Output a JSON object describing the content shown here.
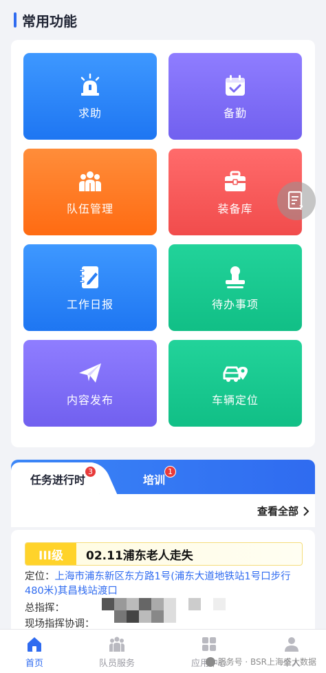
{
  "section": {
    "title": "常用功能"
  },
  "tiles": [
    {
      "label": "求助",
      "icon": "alarm-light-icon",
      "color": "blue"
    },
    {
      "label": "备勤",
      "icon": "calendar-check-icon",
      "color": "purple"
    },
    {
      "label": "队伍管理",
      "icon": "team-icon",
      "color": "orange"
    },
    {
      "label": "装备库",
      "icon": "toolbox-icon",
      "color": "red"
    },
    {
      "label": "工作日报",
      "icon": "notebook-pen-icon",
      "color": "blue"
    },
    {
      "label": "待办事项",
      "icon": "stamp-icon",
      "color": "green"
    },
    {
      "label": "内容发布",
      "icon": "paper-plane-icon",
      "color": "purple"
    },
    {
      "label": "车辆定位",
      "icon": "car-location-icon",
      "color": "green"
    }
  ],
  "floating_help": {
    "icon": "document-question-icon"
  },
  "tabs": [
    {
      "label": "任务进行时",
      "badge": "3",
      "active": true
    },
    {
      "label": "培训",
      "badge": "1",
      "active": false
    }
  ],
  "view_all": {
    "label": "查看全部"
  },
  "task": {
    "level": "III级",
    "title": "02.11浦东老人走失",
    "location_label": "定位：",
    "location_value": "上海市浦东新区东方路1号(浦东大道地铁站1号口步行480米)其昌栈站渡口",
    "commander_label": "总指挥：",
    "site_commander_label": "现场指挥协调："
  },
  "bottom_nav": [
    {
      "label": "首页",
      "icon": "home-icon",
      "active": true
    },
    {
      "label": "队员服务",
      "icon": "team-service-icon",
      "active": false
    },
    {
      "label": "应用中心",
      "icon": "apps-icon",
      "active": false
    },
    {
      "label": "个人",
      "icon": "person-icon",
      "active": false
    }
  ],
  "watermark": {
    "text": "服务号 · BSR上海盛大数据"
  },
  "colors": {
    "accent": "#2f6bf0",
    "badge": "#e83a3a",
    "level": "#ffd32a"
  }
}
